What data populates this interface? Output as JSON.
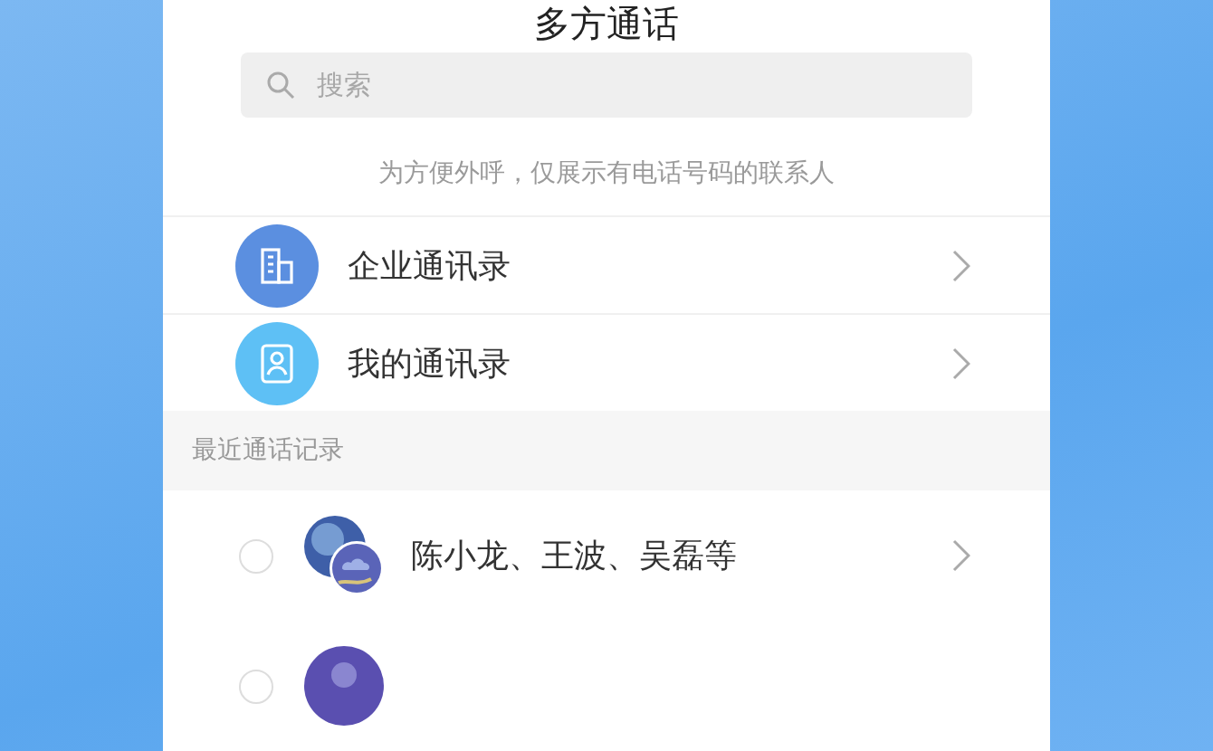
{
  "title": "多方通话",
  "search": {
    "placeholder": "搜索"
  },
  "hint": "为方便外呼，仅展示有电话号码的联系人",
  "directories": [
    {
      "kind": "company",
      "label": "企业通讯录"
    },
    {
      "kind": "personal",
      "label": "我的通讯录"
    }
  ],
  "recent_section": {
    "title": "最近通话记录"
  },
  "recent_calls": [
    {
      "names": "陈小龙、王波、吴磊等",
      "selected": false,
      "kind": "group"
    },
    {
      "selected": false,
      "kind": "single"
    }
  ]
}
